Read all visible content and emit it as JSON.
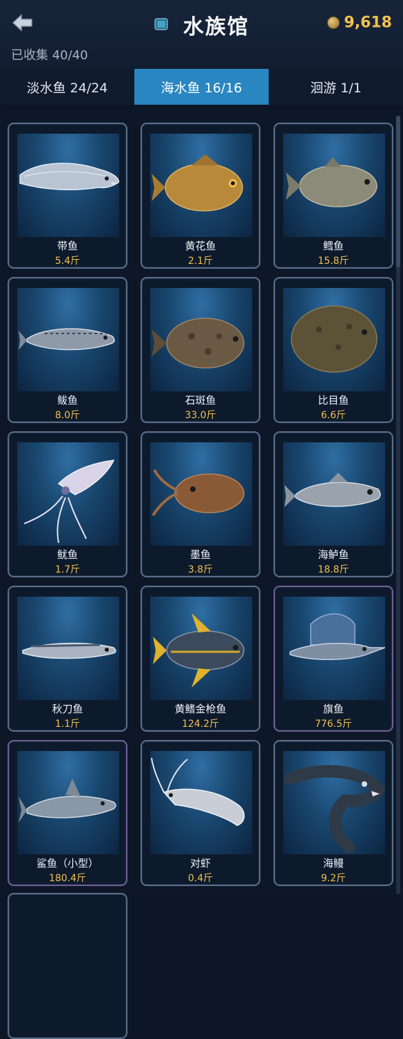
{
  "header": {
    "title": "水族馆",
    "coins": "9,618",
    "collected": "已收集 40/40"
  },
  "tabs": [
    {
      "label": "淡水鱼 24/24",
      "active": false
    },
    {
      "label": "海水鱼 16/16",
      "active": true
    },
    {
      "label": "洄游 1/1",
      "active": false
    }
  ],
  "fish": [
    {
      "name": "带鱼",
      "weight": "5.4斤"
    },
    {
      "name": "黄花鱼",
      "weight": "2.1斤"
    },
    {
      "name": "鳕鱼",
      "weight": "15.8斤"
    },
    {
      "name": "鲅鱼",
      "weight": "8.0斤"
    },
    {
      "name": "石斑鱼",
      "weight": "33.0斤"
    },
    {
      "name": "比目鱼",
      "weight": "6.6斤"
    },
    {
      "name": "鱿鱼",
      "weight": "1.7斤"
    },
    {
      "name": "墨鱼",
      "weight": "3.8斤"
    },
    {
      "name": "海鲈鱼",
      "weight": "18.8斤"
    },
    {
      "name": "秋刀鱼",
      "weight": "1.1斤"
    },
    {
      "name": "黄鳍金枪鱼",
      "weight": "124.2斤"
    },
    {
      "name": "旗鱼",
      "weight": "776.5斤"
    },
    {
      "name": "鲨鱼（小型）",
      "weight": "180.4斤"
    },
    {
      "name": "对虾",
      "weight": "0.4斤"
    },
    {
      "name": "海鳗",
      "weight": "9.2斤"
    }
  ],
  "colors": {
    "accent": "#2a86c0",
    "gold": "#f2c14e",
    "background": "#0c1626"
  },
  "icons": {
    "back": "back-arrow-icon",
    "title": "aquarium-box-icon",
    "coin": "coin-icon"
  }
}
